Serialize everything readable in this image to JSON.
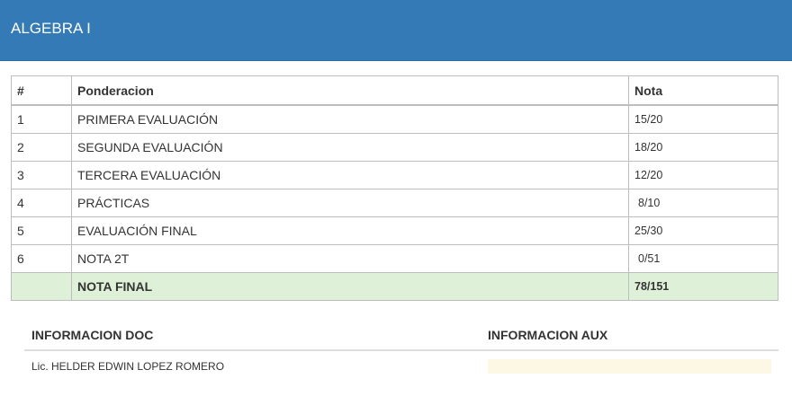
{
  "header": {
    "title": "ALGEBRA I"
  },
  "table": {
    "headers": {
      "num": "#",
      "weight": "Ponderacion",
      "grade": "Nota"
    },
    "rows": [
      {
        "num": "1",
        "label": "PRIMERA EVALUACIÓN",
        "grade": "15/20"
      },
      {
        "num": "2",
        "label": "SEGUNDA EVALUACIÓN",
        "grade": "18/20"
      },
      {
        "num": "3",
        "label": "TERCERA EVALUACIÓN",
        "grade": "12/20"
      },
      {
        "num": "4",
        "label": "PRÁCTICAS",
        "grade": "8/10"
      },
      {
        "num": "5",
        "label": "EVALUACIÓN FINAL",
        "grade": "25/30"
      },
      {
        "num": "6",
        "label": "NOTA 2T",
        "grade": "0/51"
      }
    ],
    "total": {
      "num": "",
      "label": "NOTA FINAL",
      "grade": "78/151"
    }
  },
  "info": {
    "doc_header": "INFORMACION DOC",
    "aux_header": "INFORMACION AUX",
    "doc_value": "Lic. HELDER EDWIN LOPEZ ROMERO",
    "aux_value": ""
  },
  "colors": {
    "header_bg": "#337ab7",
    "total_row_bg": "#dff0d8",
    "aux_value_bg": "#fcf8e3"
  }
}
